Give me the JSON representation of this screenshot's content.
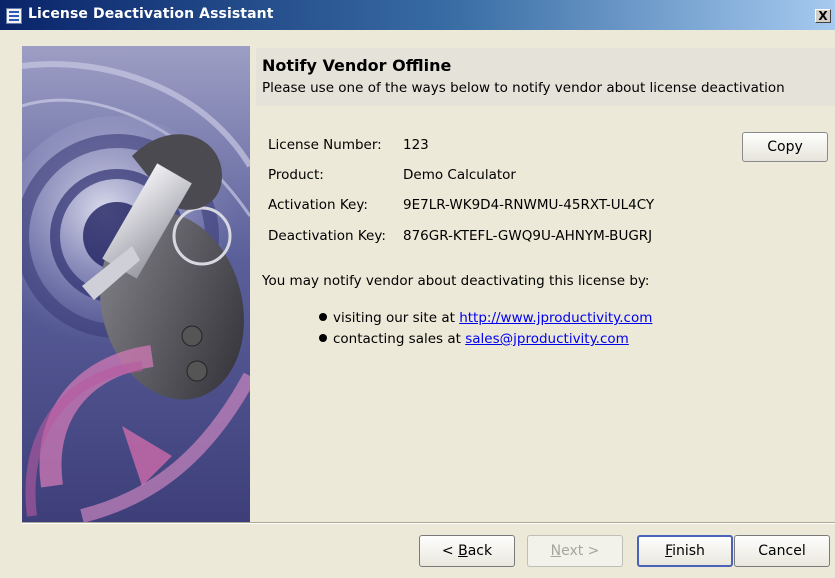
{
  "window": {
    "title": "License Deactivation Assistant",
    "close_label": "X"
  },
  "header": {
    "title": "Notify Vendor Offline",
    "subtitle": "Please use one of the ways below to notify vendor about license deactivation"
  },
  "details": [
    {
      "label": "License Number:",
      "value": "123"
    },
    {
      "label": "Product:",
      "value": "Demo Calculator"
    },
    {
      "label": "Activation Key:",
      "value": "9E7LR-WK9D4-RNWMU-45RXT-UL4CY"
    },
    {
      "label": "Deactivation Key:",
      "value": "876GR-KTEFL-GWQ9U-AHNYM-BUGRJ"
    }
  ],
  "copy_label": "Copy",
  "notify": {
    "intro": "You may notify vendor about deactivating this license by:",
    "site_prefix": "visiting our site at",
    "site_link": "http://www.jproductivity.com",
    "sales_prefix": "contacting sales at",
    "sales_link": "sales@jproductivity.com"
  },
  "buttons": {
    "back_prefix": "< ",
    "back_mnemonic": "B",
    "back_rest": "ack",
    "next_mnemonic": "N",
    "next_rest": "ext >",
    "finish_mnemonic": "F",
    "finish_rest": "inish",
    "cancel": "Cancel"
  },
  "colors": {
    "titlebar": "#0a246a",
    "dialog_bg": "#ece9d8",
    "link": "#0000ee"
  }
}
